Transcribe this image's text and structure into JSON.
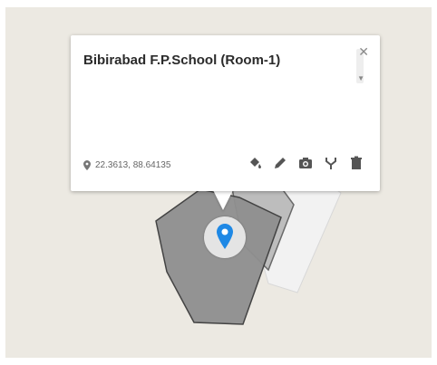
{
  "popup": {
    "title": "Bibirabad F.P.School (Room-1)",
    "coordinates": "22.3613, 88.64135",
    "close_symbol": "✕",
    "tools": [
      {
        "name": "paint-bucket-icon",
        "label": "Style"
      },
      {
        "name": "pencil-icon",
        "label": "Edit"
      },
      {
        "name": "camera-icon",
        "label": "Add photo"
      },
      {
        "name": "directions-icon",
        "label": "Directions"
      },
      {
        "name": "trash-icon",
        "label": "Delete"
      }
    ]
  },
  "map": {
    "colors": {
      "background": "#ece9e2",
      "polygon_main": "#8f8f8f",
      "polygon_secondary": "#bdbdbd",
      "polygon_light": "#f2f2f2",
      "marker": "#1e88e5"
    },
    "marker_icon": "map-pin-icon"
  }
}
